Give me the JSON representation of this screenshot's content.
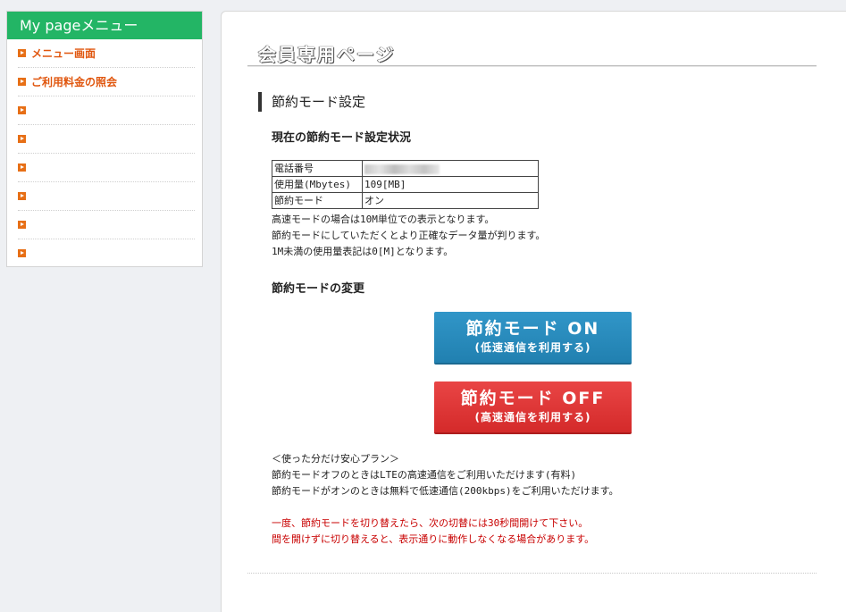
{
  "sidebar": {
    "title": "My pageメニュー",
    "items": [
      {
        "label": "メニュー画面"
      },
      {
        "label": "ご利用料金の照会"
      },
      {
        "label": ""
      },
      {
        "label": ""
      },
      {
        "label": ""
      },
      {
        "label": ""
      },
      {
        "label": ""
      },
      {
        "label": ""
      }
    ]
  },
  "main": {
    "page_title": "会員専用ページ",
    "section_title": "節約モード設定",
    "status_heading": "現在の節約モード設定状況",
    "status_table": [
      {
        "key": "電話番号",
        "value": ""
      },
      {
        "key": "使用量(Mbytes)",
        "value": "109[MB]"
      },
      {
        "key": "節約モード",
        "value": "オン"
      }
    ],
    "status_notes": [
      "高速モードの場合は10M単位での表示となります。",
      "節約モードにしていただくとより正確なデータ量が判ります。",
      "1M未満の使用量表記は0[M]となります。"
    ],
    "change_heading": "節約モードの変更",
    "btn_on": {
      "line1": "節約モード ON",
      "line2": "(低速通信を利用する)"
    },
    "btn_off": {
      "line1": "節約モード OFF",
      "line2": "(高速通信を利用する)"
    },
    "plan_notes": [
      "＜使った分だけ安心プラン＞",
      "節約モードオフのときはLTEの高速通信をご利用いただけます(有料)",
      "節約モードがオンのときは無料で低速通信(200kbps)をご利用いただけます。"
    ],
    "warning_notes": [
      "一度、節約モードを切り替えたら、次の切替には30秒間開けて下さい。",
      "間を開けずに切り替えると、表示通りに動作しなくなる場合があります。"
    ]
  },
  "colors": {
    "sidebar_header": "#23b565",
    "menu_link": "#e0560e",
    "btn_on": "#2a8cbf",
    "btn_off": "#dd3535",
    "warning": "#c80000"
  }
}
